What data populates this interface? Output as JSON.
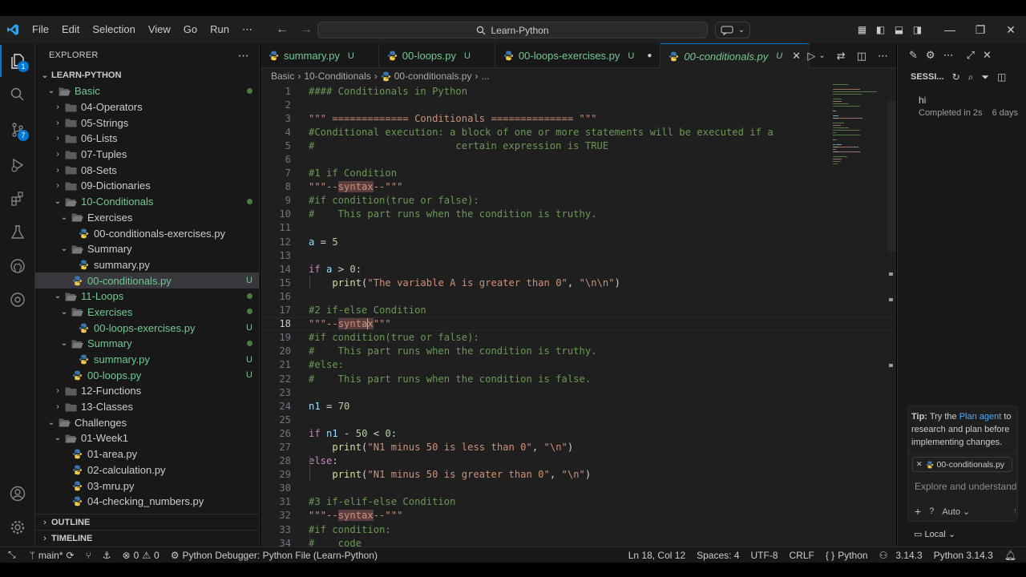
{
  "menu": [
    "File",
    "Edit",
    "Selection",
    "View",
    "Go",
    "Run"
  ],
  "search": {
    "label": "Learn-Python"
  },
  "sidebar": {
    "title": "EXPLORER",
    "root": "LEARN-PYTHON",
    "tree": [
      {
        "label": "Basic",
        "type": "folder-open",
        "indent": 1,
        "status": "dot",
        "color": "#73c991"
      },
      {
        "label": "04-Operators",
        "type": "folder",
        "indent": 2,
        "status": ""
      },
      {
        "label": "05-Strings",
        "type": "folder",
        "indent": 2,
        "status": ""
      },
      {
        "label": "06-Lists",
        "type": "folder",
        "indent": 2,
        "status": ""
      },
      {
        "label": "07-Tuples",
        "type": "folder",
        "indent": 2,
        "status": ""
      },
      {
        "label": "08-Sets",
        "type": "folder",
        "indent": 2,
        "status": ""
      },
      {
        "label": "09-Dictionaries",
        "type": "folder",
        "indent": 2,
        "status": ""
      },
      {
        "label": "10-Conditionals",
        "type": "folder-open",
        "indent": 2,
        "status": "dot",
        "color": "#73c991"
      },
      {
        "label": "Exercises",
        "type": "folder-open",
        "indent": 3,
        "status": ""
      },
      {
        "label": "00-conditionals-exercises.py",
        "type": "py",
        "indent": 4,
        "status": ""
      },
      {
        "label": "Summary",
        "type": "folder-open",
        "indent": 3,
        "status": ""
      },
      {
        "label": "summary.py",
        "type": "py",
        "indent": 4,
        "status": ""
      },
      {
        "label": "00-conditionals.py",
        "type": "py",
        "indent": 3,
        "status": "U",
        "color": "#73c991",
        "selected": true
      },
      {
        "label": "11-Loops",
        "type": "folder-open",
        "indent": 2,
        "status": "dot",
        "color": "#73c991"
      },
      {
        "label": "Exercises",
        "type": "folder-open",
        "indent": 3,
        "status": "dot",
        "color": "#73c991"
      },
      {
        "label": "00-loops-exercises.py",
        "type": "py",
        "indent": 4,
        "status": "U",
        "color": "#73c991"
      },
      {
        "label": "Summary",
        "type": "folder-open",
        "indent": 3,
        "status": "dot",
        "color": "#73c991"
      },
      {
        "label": "summary.py",
        "type": "py",
        "indent": 4,
        "status": "U",
        "color": "#73c991"
      },
      {
        "label": "00-loops.py",
        "type": "py",
        "indent": 3,
        "status": "U",
        "color": "#73c991"
      },
      {
        "label": "12-Functions",
        "type": "folder",
        "indent": 2,
        "status": ""
      },
      {
        "label": "13-Classes",
        "type": "folder",
        "indent": 2,
        "status": ""
      },
      {
        "label": "Challenges",
        "type": "folder-open",
        "indent": 1,
        "status": ""
      },
      {
        "label": "01-Week1",
        "type": "folder-open",
        "indent": 2,
        "status": ""
      },
      {
        "label": "01-area.py",
        "type": "py",
        "indent": 3,
        "status": ""
      },
      {
        "label": "02-calculation.py",
        "type": "py",
        "indent": 3,
        "status": ""
      },
      {
        "label": "03-mru.py",
        "type": "py",
        "indent": 3,
        "status": ""
      },
      {
        "label": "04-checking_numbers.py",
        "type": "py",
        "indent": 3,
        "status": ""
      }
    ],
    "outline": "OUTLINE",
    "timeline": "TIMELINE"
  },
  "tabs": [
    {
      "label": "summary.py",
      "badge": "U",
      "active": false
    },
    {
      "label": "00-loops.py",
      "badge": "U",
      "active": false
    },
    {
      "label": "00-loops-exercises.py",
      "badge": "U",
      "active": false,
      "dirty": true
    },
    {
      "label": "00-conditionals.py",
      "badge": "U",
      "active": true
    }
  ],
  "breadcrumb": [
    "Basic",
    "10-Conditionals",
    "00-conditionals.py",
    "..."
  ],
  "code": [
    [
      [
        "c-cm",
        "#### Conditionals in Python"
      ]
    ],
    [],
    [
      [
        "c-str",
        "\"\"\" ============= Conditionals ============== \"\"\""
      ]
    ],
    [
      [
        "c-cm",
        "#Conditional execution: a block of one or more statements will be executed if a"
      ]
    ],
    [
      [
        "c-cm",
        "#                        certain expression is TRUE"
      ]
    ],
    [],
    [
      [
        "c-cm",
        "#1 if Condition"
      ]
    ],
    [
      [
        "c-str",
        "\"\"\"--"
      ],
      [
        "c-str c-hl",
        "syntax"
      ],
      [
        "c-str",
        "--\"\"\""
      ]
    ],
    [
      [
        "c-cm",
        "#if condition(true or false):"
      ]
    ],
    [
      [
        "c-cm",
        "#    This part runs when the condition is truthy."
      ]
    ],
    [],
    [
      [
        "c-var",
        "a"
      ],
      [
        "c-op",
        " = "
      ],
      [
        "c-num",
        "5"
      ]
    ],
    [],
    [
      [
        "c-kw",
        "if"
      ],
      [
        "c-op",
        " "
      ],
      [
        "c-var",
        "a"
      ],
      [
        "c-op",
        " > "
      ],
      [
        "c-num",
        "0"
      ],
      [
        "c-op",
        ":"
      ]
    ],
    [
      [
        "c-op",
        "    "
      ],
      [
        "c-fn",
        "print"
      ],
      [
        "c-op",
        "("
      ],
      [
        "c-str",
        "\"The variable A is greater than 0\""
      ],
      [
        "c-op",
        ", "
      ],
      [
        "c-str",
        "\"\\n\\n\""
      ],
      [
        "c-op",
        ")"
      ]
    ],
    [],
    [
      [
        "c-cm",
        "#2 if-else Condition"
      ]
    ],
    [
      [
        "c-str",
        "\"\"\"--"
      ],
      [
        "c-str c-hl",
        "syntax"
      ],
      [
        "c-str",
        "\"\"\""
      ]
    ],
    [
      [
        "c-cm",
        "#if condition(true or false):"
      ]
    ],
    [
      [
        "c-cm",
        "#    This part runs when the condition is truthy."
      ]
    ],
    [
      [
        "c-cm",
        "#else:"
      ]
    ],
    [
      [
        "c-cm",
        "#    This part runs when the condition is false."
      ]
    ],
    [],
    [
      [
        "c-var",
        "n1"
      ],
      [
        "c-op",
        " = "
      ],
      [
        "c-num",
        "70"
      ]
    ],
    [],
    [
      [
        "c-kw",
        "if"
      ],
      [
        "c-op",
        " "
      ],
      [
        "c-var",
        "n1"
      ],
      [
        "c-op",
        " - "
      ],
      [
        "c-num",
        "50"
      ],
      [
        "c-op",
        " < "
      ],
      [
        "c-num",
        "0"
      ],
      [
        "c-op",
        ":"
      ]
    ],
    [
      [
        "c-op",
        "    "
      ],
      [
        "c-fn",
        "print"
      ],
      [
        "c-op",
        "("
      ],
      [
        "c-str",
        "\"N1 minus 50 is less than 0\""
      ],
      [
        "c-op",
        ", "
      ],
      [
        "c-str",
        "\"\\n\""
      ],
      [
        "c-op",
        ")"
      ]
    ],
    [
      [
        "c-kw",
        "else"
      ],
      [
        "c-op",
        ":"
      ]
    ],
    [
      [
        "c-op",
        "    "
      ],
      [
        "c-fn",
        "print"
      ],
      [
        "c-op",
        "("
      ],
      [
        "c-str",
        "\"N1 minus 50 is greater than 0\""
      ],
      [
        "c-op",
        ", "
      ],
      [
        "c-str",
        "\"\\n\""
      ],
      [
        "c-op",
        ")"
      ]
    ],
    [],
    [
      [
        "c-cm",
        "#3 if-elif-else Condition"
      ]
    ],
    [
      [
        "c-str",
        "\"\"\"--"
      ],
      [
        "c-str c-hl",
        "syntax"
      ],
      [
        "c-str",
        "--\"\"\""
      ]
    ],
    [
      [
        "c-cm",
        "#if condition:"
      ]
    ],
    [
      [
        "c-cm",
        "#    code"
      ]
    ]
  ],
  "current_line": 18,
  "chat": {
    "title": "SESSI...",
    "session_name": "hi",
    "session_status": "Completed in 2s",
    "session_age": "6 days",
    "tip_prefix": "Tip:",
    "tip_text1": "Try the",
    "tip_link": "Plan agent",
    "tip_text2": "to research and plan before implementing changes.",
    "attachment": "00-conditionals.py",
    "placeholder": "Explore and understand y",
    "mode": "Auto",
    "local": "Local"
  },
  "statusbar": {
    "branch": "main*",
    "errors": "0",
    "warnings": "0",
    "debugger": "Python Debugger: Python File (Learn-Python)",
    "position": "Ln 18, Col 12",
    "spaces": "Spaces: 4",
    "encoding": "UTF-8",
    "eol": "CRLF",
    "language": "Python",
    "version1": "3.14.3",
    "version2": "Python 3.14.3"
  },
  "badges": {
    "explorer": "1",
    "scm": "7"
  },
  "colors": {
    "accent": "#0078d4",
    "untracked": "#73c991",
    "background": "#1f1f1f"
  }
}
